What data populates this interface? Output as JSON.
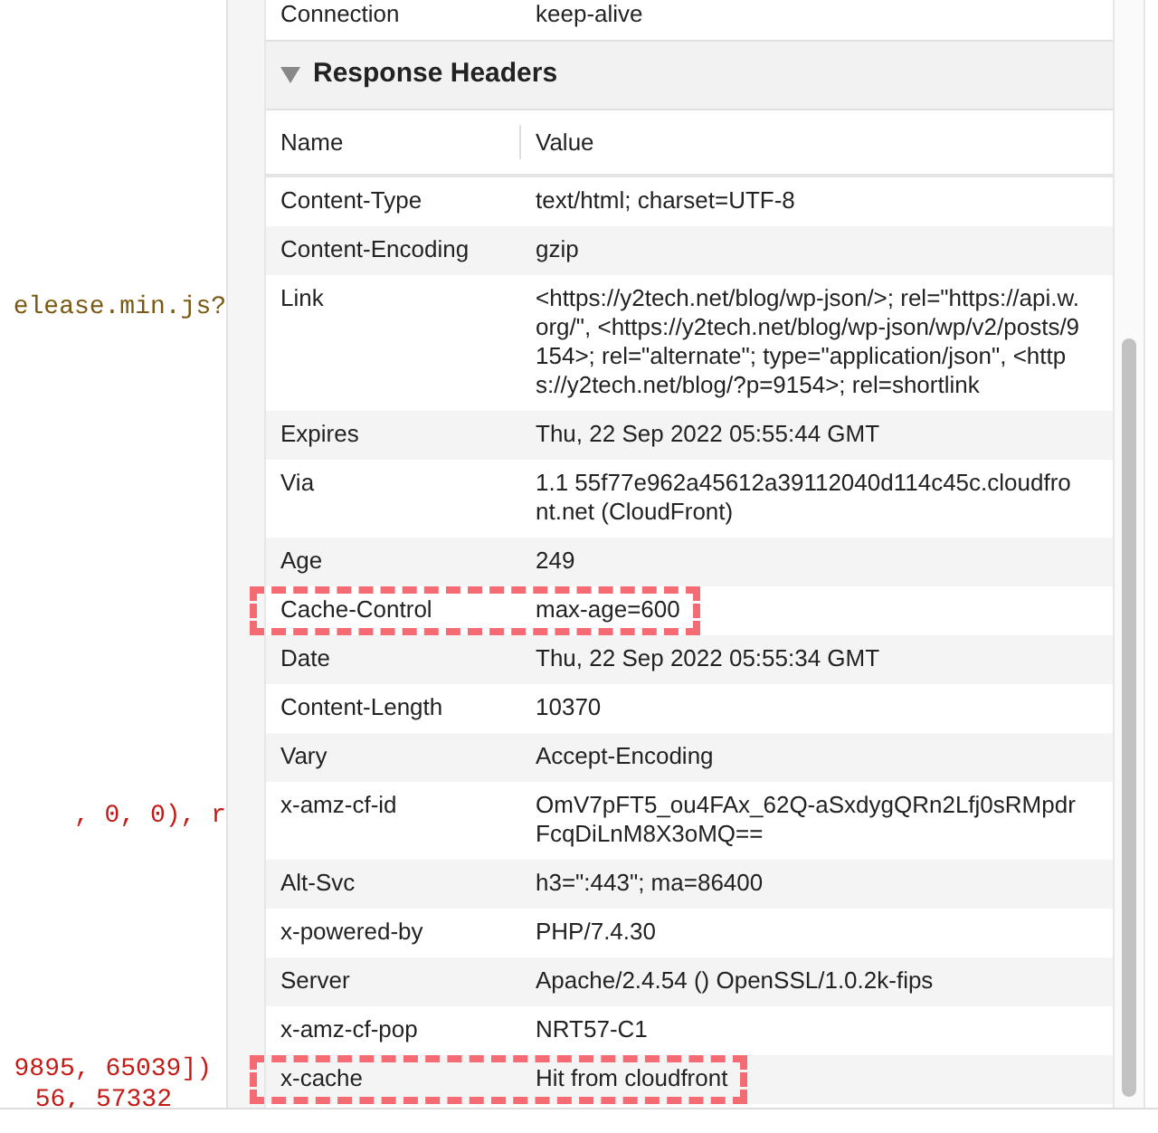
{
  "code_lines": [
    {
      "kind": "string",
      "text": "elease.min.js?"
    },
    {
      "kind": "error",
      "text": ", 0, 0), r"
    },
    {
      "kind": "error",
      "text": "9895, 65039])"
    },
    {
      "kind": "error",
      "text": "56, 57332"
    }
  ],
  "previous_row": {
    "name": "Connection",
    "value": "keep-alive"
  },
  "section": {
    "title": "Response Headers",
    "expanded": true
  },
  "columns": [
    "Name",
    "Value"
  ],
  "rows": [
    {
      "name": "Content-Type",
      "value": "text/html; charset=UTF-8",
      "highlighted": false
    },
    {
      "name": "Content-Encoding",
      "value": "gzip",
      "highlighted": false
    },
    {
      "name": "Link",
      "value": "<https://y2tech.net/blog/wp-json/>; rel=\"https://api.w.org/\", <https://y2tech.net/blog/wp-json/wp/v2/posts/9154>; rel=\"alternate\"; type=\"application/json\", <https://y2tech.net/blog/?p=9154>; rel=shortlink",
      "highlighted": false
    },
    {
      "name": "Expires",
      "value": "Thu, 22 Sep 2022 05:55:44 GMT",
      "highlighted": false
    },
    {
      "name": "Via",
      "value": "1.1 55f77e962a45612a39112040d114c45c.cloudfront.net (CloudFront)",
      "highlighted": false
    },
    {
      "name": "Age",
      "value": "249",
      "highlighted": false
    },
    {
      "name": "Cache-Control",
      "value": "max-age=600",
      "highlighted": true
    },
    {
      "name": "Date",
      "value": "Thu, 22 Sep 2022 05:55:34 GMT",
      "highlighted": false
    },
    {
      "name": "Content-Length",
      "value": "10370",
      "highlighted": false
    },
    {
      "name": "Vary",
      "value": "Accept-Encoding",
      "highlighted": false
    },
    {
      "name": "x-amz-cf-id",
      "value": "OmV7pFT5_ou4FAx_62Q-aSxdygQRn2Lfj0sRMpdrFcqDiLnM8X3oMQ==",
      "highlighted": false
    },
    {
      "name": "Alt-Svc",
      "value": "h3=\":443\"; ma=86400",
      "highlighted": false
    },
    {
      "name": "x-powered-by",
      "value": "PHP/7.4.30",
      "highlighted": false
    },
    {
      "name": "Server",
      "value": "Apache/2.4.54 () OpenSSL/1.0.2k-fips",
      "highlighted": false
    },
    {
      "name": "x-amz-cf-pop",
      "value": "NRT57-C1",
      "highlighted": false
    },
    {
      "name": "x-cache",
      "value": "Hit from cloudfront",
      "highlighted": true
    }
  ]
}
